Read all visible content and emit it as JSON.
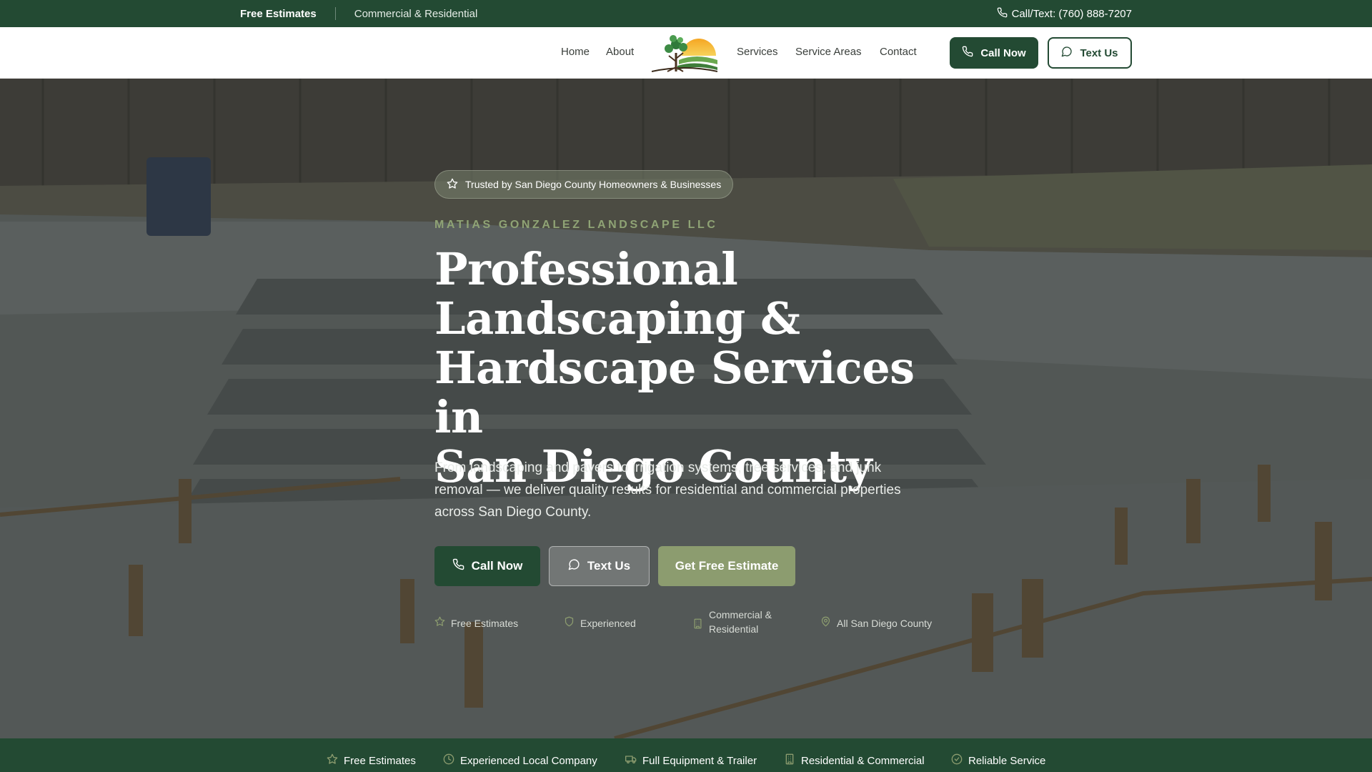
{
  "topbar": {
    "free_estimates": "Free Estimates",
    "commercial_residential": "Commercial & Residential",
    "phone": "Call/Text: (760) 888-7207"
  },
  "nav": {
    "home": "Home",
    "about": "About",
    "services": "Services",
    "service_areas": "Service Areas",
    "contact": "Contact",
    "call_now": "Call Now",
    "text_us": "Text Us"
  },
  "hero": {
    "trust_badge": "Trusted by San Diego County Homeowners & Businesses",
    "company": "MATIAS GONZALEZ LANDSCAPE LLC",
    "headline_lines": [
      "Professional",
      "Landscaping &",
      "Hardscape Services in",
      "San Diego County"
    ],
    "subtext": "From landscaping and pavers to irrigation systems, tree services, and junk removal — we deliver quality results for residential and commercial properties across San Diego County.",
    "cta_call": "Call Now",
    "cta_text": "Text Us",
    "cta_estimate": "Get Free Estimate",
    "features": [
      {
        "icon": "star-icon",
        "label": "Free Estimates"
      },
      {
        "icon": "shield-icon",
        "label": "Experienced"
      },
      {
        "icon": "building-icon",
        "label": "Commercial &\nResidential"
      },
      {
        "icon": "map-pin-icon",
        "label": "All San Diego County"
      }
    ]
  },
  "bottombar": {
    "items": [
      {
        "icon": "star-icon",
        "label": "Free Estimates"
      },
      {
        "icon": "clock-icon",
        "label": "Experienced Local Company"
      },
      {
        "icon": "truck-icon",
        "label": "Full Equipment & Trailer"
      },
      {
        "icon": "building-icon",
        "label": "Residential & Commercial"
      },
      {
        "icon": "check-circle-icon",
        "label": "Reliable Service"
      }
    ]
  },
  "colors": {
    "brand_green": "#234a33",
    "accent_olive": "#8c9c6f",
    "company_label": "#8fa375"
  }
}
